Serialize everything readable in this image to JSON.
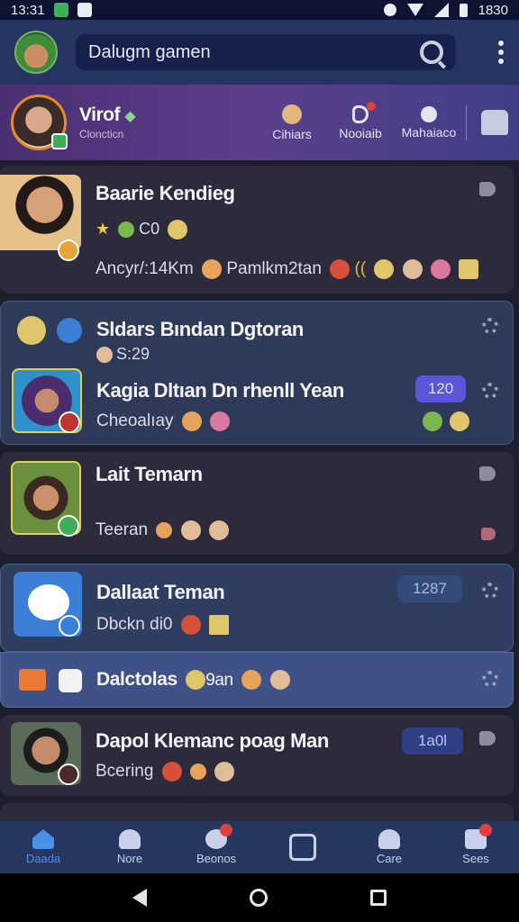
{
  "status_bar": {
    "time": "13:31",
    "right_time": "1830"
  },
  "app_bar": {
    "search_text": "Dalugm gamen"
  },
  "profile": {
    "name": "Virof",
    "subtitle": "Cloncticn",
    "stats": [
      {
        "label": "Cihiars",
        "icon": "coin-icon"
      },
      {
        "label": "Nooiaib",
        "icon": "message-icon",
        "badge": true
      },
      {
        "label": "Mahaiaco",
        "icon": "person-icon"
      }
    ]
  },
  "chats": [
    {
      "title": "Baarie Kendieg",
      "line1": "★   C0",
      "line2_a": "Ancyr/:14Km",
      "line2_b": "Pamlkm2tan",
      "line2_c": "(("
    },
    {
      "title": "Sldars Bından Dgtoran",
      "line1": "S:29",
      "title2": "Kagia Dltıan Dn rhenll Yean",
      "line2": "Cheoalıay",
      "pill": "120"
    },
    {
      "title": "Lait Temarn",
      "line2": "Teeran"
    },
    {
      "title": "Dallaat Teman",
      "line2": "Dbckn di0",
      "pill": "1287"
    },
    {
      "title": "Dalctolas",
      "suffix": "9an"
    },
    {
      "title": "Dapol Klemanc poag Man",
      "line2": "Bcering",
      "pill": "1a0l"
    }
  ],
  "bottom_nav": [
    {
      "label": "Daada",
      "active": true
    },
    {
      "label": "Nore"
    },
    {
      "label": "Beonos",
      "badge": true
    },
    {
      "label": ""
    },
    {
      "label": "Care"
    },
    {
      "label": "Sees",
      "badge": true
    }
  ]
}
